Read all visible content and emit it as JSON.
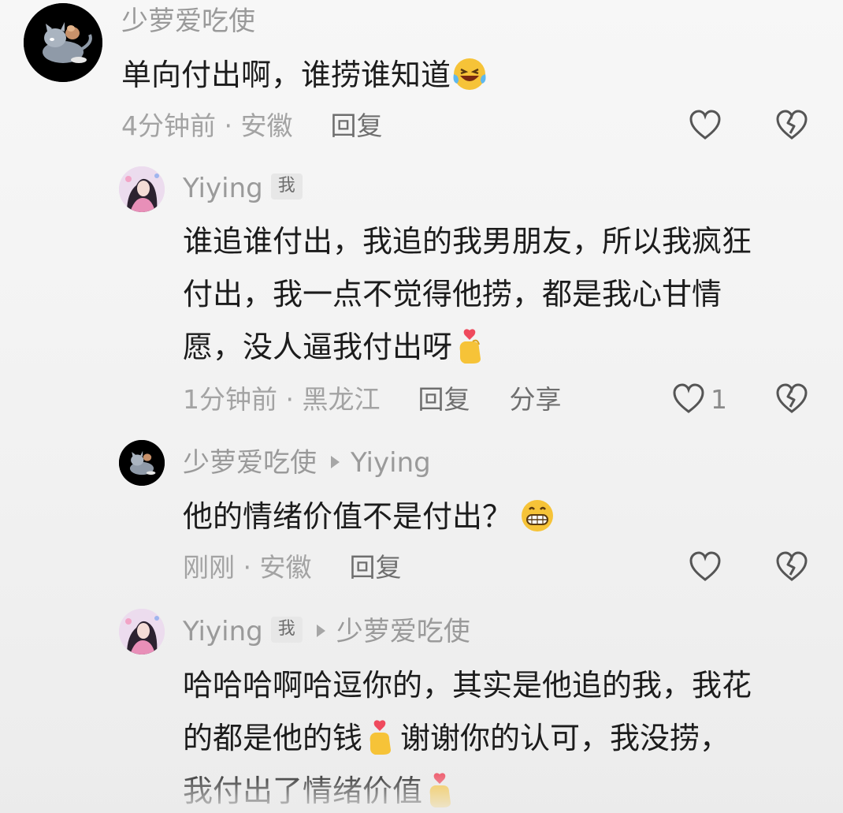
{
  "comments": [
    {
      "author": "少萝爱吃使",
      "text_lines": [
        "单向付出啊，谁捞谁知道"
      ],
      "text_emoji": "laughing-tears",
      "time_location": "4分钟前 · 安徽",
      "reply_label": "回复"
    },
    {
      "author": "Yiying",
      "me_badge": "我",
      "text_lines": [
        "谁追谁付出，我追的我男朋友，所以我疯狂",
        "付出，我一点不觉得他捞，都是我心甘情",
        "愿，没人逼我付出呀"
      ],
      "time_location": "1分钟前 · 黑龙江",
      "reply_label": "回复",
      "share_label": "分享",
      "like_count": "1"
    },
    {
      "author": "少萝爱吃使",
      "reply_to": "Yiying",
      "text_lines": [
        "他的情绪价值不是付出？"
      ],
      "time_location": "刚刚 · 安徽",
      "reply_label": "回复"
    },
    {
      "author": "Yiying",
      "me_badge": "我",
      "reply_to": "少萝爱吃使",
      "text_lines": [
        "哈哈哈啊哈逗你的，其实是他追的我，我花",
        "的都是他的钱",
        "谢谢你的认可，我没捞，",
        "我付出了情绪价值"
      ]
    }
  ],
  "colors": {
    "meta_gray": "#a3a3a3",
    "action_gray": "#6f6f6f",
    "text": "#1c1c1c"
  }
}
